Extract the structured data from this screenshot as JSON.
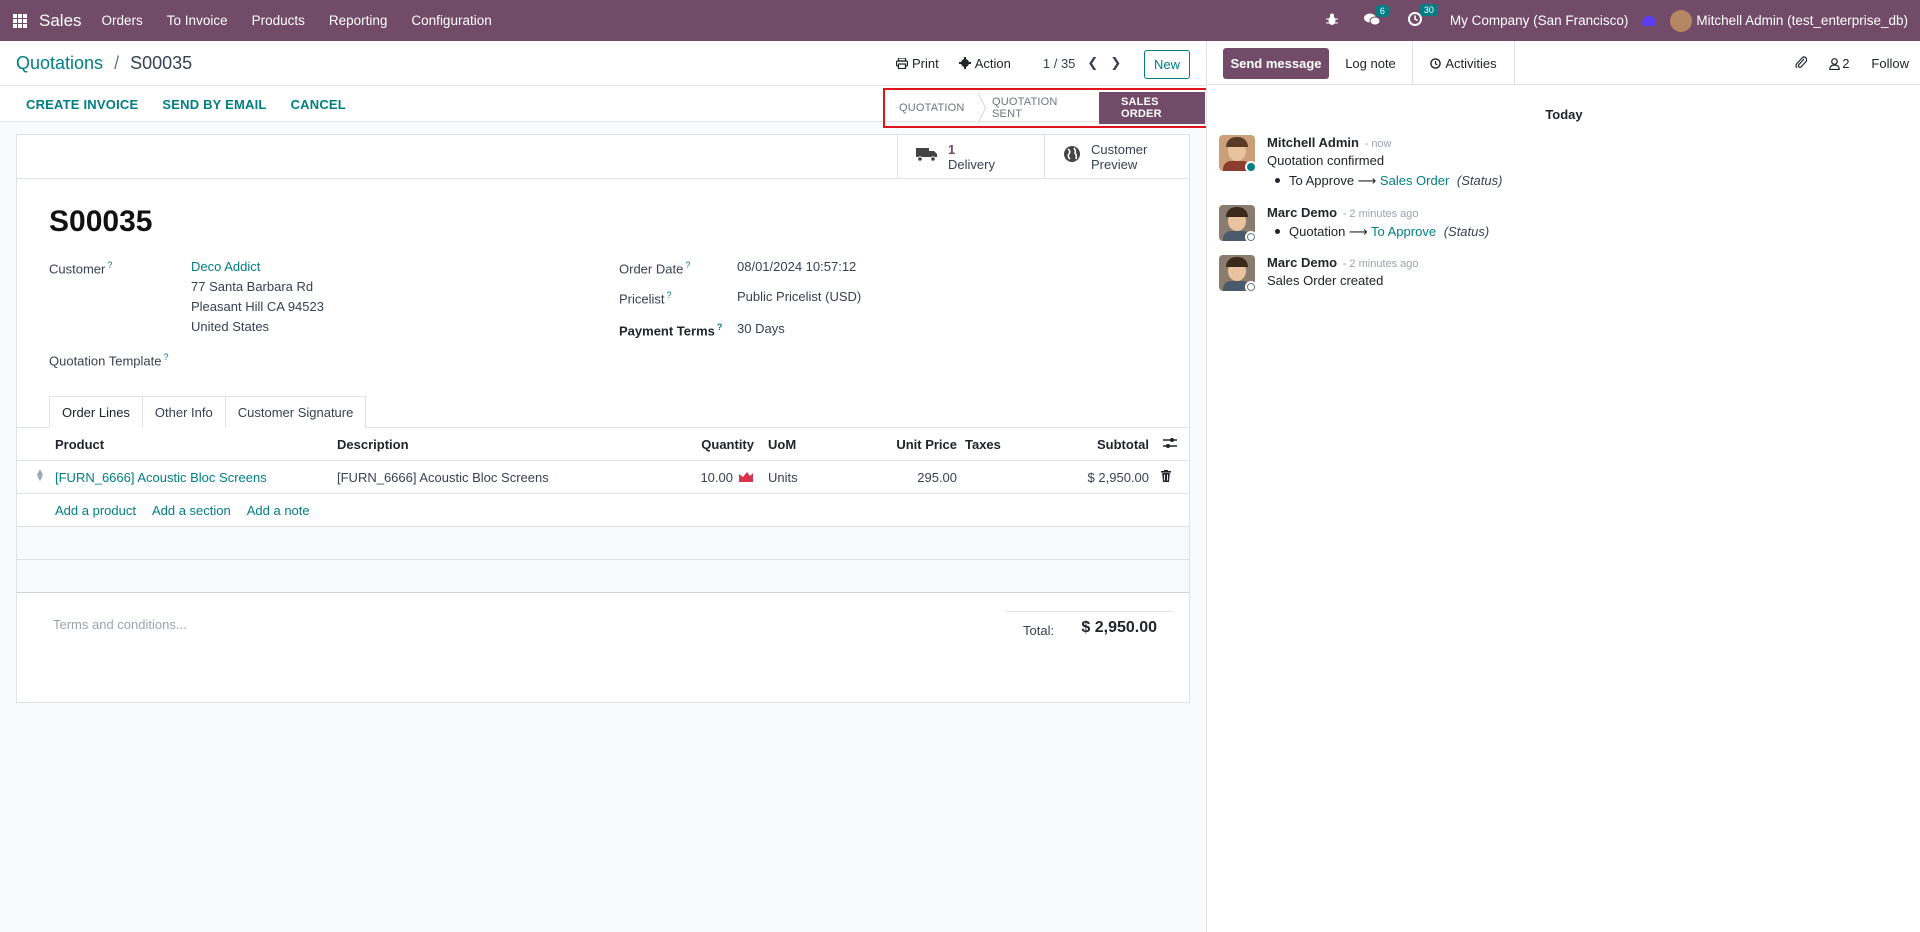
{
  "navbar": {
    "app_name": "Sales",
    "menu": [
      "Orders",
      "To Invoice",
      "Products",
      "Reporting",
      "Configuration"
    ],
    "messages_badge": "6",
    "activities_badge": "30",
    "company": "My Company (San Francisco)",
    "user": "Mitchell Admin (test_enterprise_db)"
  },
  "control": {
    "breadcrumb_parent": "Quotations",
    "breadcrumb_sep": "/",
    "breadcrumb_current": "S00035",
    "print_label": "Print",
    "action_label": "Action",
    "pager": "1 / 35",
    "new_label": "New"
  },
  "status": {
    "actions": [
      "CREATE INVOICE",
      "SEND BY EMAIL",
      "CANCEL"
    ],
    "stages": [
      "QUOTATION",
      "QUOTATION SENT",
      "SALES ORDER"
    ],
    "active_stage": "SALES ORDER"
  },
  "smart_buttons": {
    "delivery_count": "1",
    "delivery_label": "Delivery",
    "preview_line1": "Customer",
    "preview_line2": "Preview"
  },
  "form": {
    "name": "S00035",
    "customer_label": "Customer",
    "customer_name": "Deco Addict",
    "customer_address": [
      "77 Santa Barbara Rd",
      "Pleasant Hill CA 94523",
      "United States"
    ],
    "template_label": "Quotation Template",
    "order_date_label": "Order Date",
    "order_date": "08/01/2024 10:57:12",
    "pricelist_label": "Pricelist",
    "pricelist": "Public Pricelist (USD)",
    "payment_terms_label": "Payment Terms",
    "payment_terms": "30 Days",
    "help_mark": "?"
  },
  "tabs": [
    "Order Lines",
    "Other Info",
    "Customer Signature"
  ],
  "lines": {
    "headers": {
      "product": "Product",
      "description": "Description",
      "quantity": "Quantity",
      "uom": "UoM",
      "unit_price": "Unit Price",
      "taxes": "Taxes",
      "subtotal": "Subtotal"
    },
    "rows": [
      {
        "product": "[FURN_6666] Acoustic Bloc Screens",
        "description": "[FURN_6666] Acoustic Bloc Screens",
        "quantity": "10.00",
        "uom": "Units",
        "unit_price": "295.00",
        "taxes": "",
        "subtotal": "$ 2,950.00"
      }
    ],
    "add_links": [
      "Add a product",
      "Add a section",
      "Add a note"
    ]
  },
  "footer": {
    "terms_placeholder": "Terms and conditions...",
    "total_label": "Total:",
    "total_value": "$ 2,950.00"
  },
  "chatter": {
    "send_message": "Send message",
    "log_note": "Log note",
    "activities": "Activities",
    "followers_count": "2",
    "follow": "Follow",
    "today": "Today",
    "messages": [
      {
        "author": "Mitchell Admin",
        "time": "- now",
        "body": "Quotation confirmed",
        "track_old": "To Approve",
        "track_new": "Sales Order",
        "track_field": "(Status)",
        "presence_color": "#017e84"
      },
      {
        "author": "Marc Demo",
        "time": "- 2 minutes ago",
        "track_old": "Quotation",
        "track_new": "To Approve",
        "track_field": "(Status)",
        "presence_color": "#ffffff"
      },
      {
        "author": "Marc Demo",
        "time": "- 2 minutes ago",
        "body": "Sales Order created",
        "presence_color": "#ffffff"
      }
    ]
  },
  "colors": {
    "brand": "#714b67",
    "link": "#017e84",
    "highlight_border": "#e0141b",
    "forecast_icon": "#d9334f"
  }
}
